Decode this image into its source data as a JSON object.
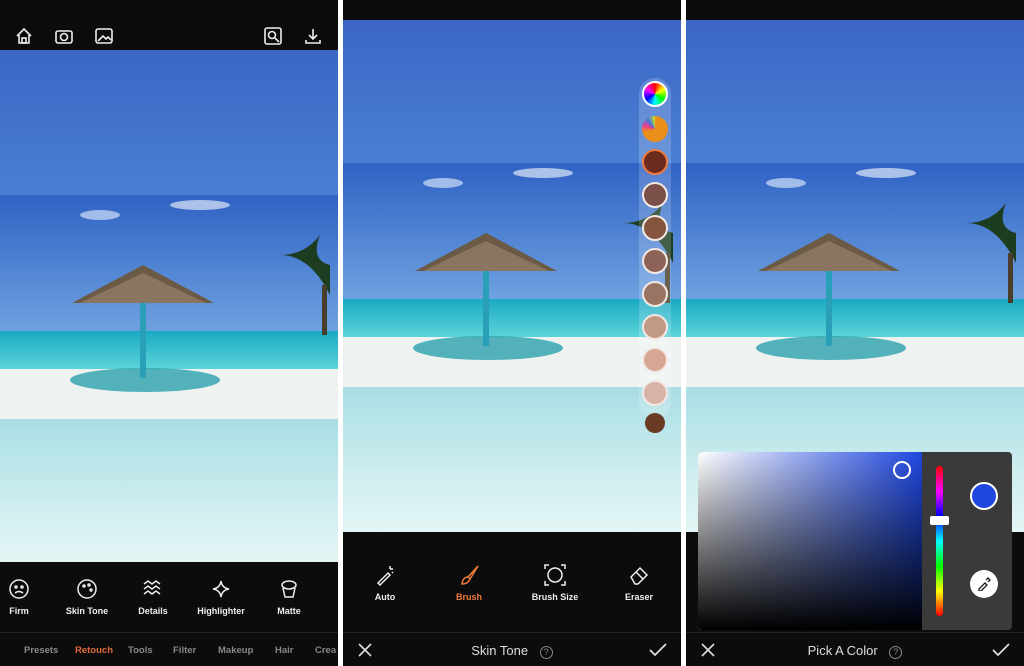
{
  "panel1": {
    "tools": [
      {
        "label": "Firm",
        "icon": "face-icon"
      },
      {
        "label": "Skin Tone",
        "icon": "palette-icon"
      },
      {
        "label": "Details",
        "icon": "waves-icon"
      },
      {
        "label": "Highlighter",
        "icon": "sparkle-icon"
      },
      {
        "label": "Matte",
        "icon": "powder-icon"
      }
    ],
    "tabs": [
      "Presets",
      "Retouch",
      "Tools",
      "Filter",
      "Makeup",
      "Hair",
      "Crea"
    ],
    "active_tab": "Retouch"
  },
  "panel2": {
    "tools": [
      {
        "label": "Auto",
        "icon": "magic-wand-icon"
      },
      {
        "label": "Brush",
        "icon": "brush-icon"
      },
      {
        "label": "Brush Size",
        "icon": "brush-size-icon"
      },
      {
        "label": "Eraser",
        "icon": "eraser-icon"
      }
    ],
    "active_tool": "Brush",
    "title": "Skin Tone",
    "swatches": [
      "#6b2a1e",
      "#7a5048",
      "#84543f",
      "#8d6358",
      "#9a7462",
      "#c19a85",
      "#d9a595",
      "#d7b3a5",
      "#6b3a24"
    ]
  },
  "panel3": {
    "title": "Pick A Color",
    "selected_color": "#1f47e0"
  },
  "colors": {
    "accent": "#f07a3c",
    "background": "#0c0c0c"
  }
}
